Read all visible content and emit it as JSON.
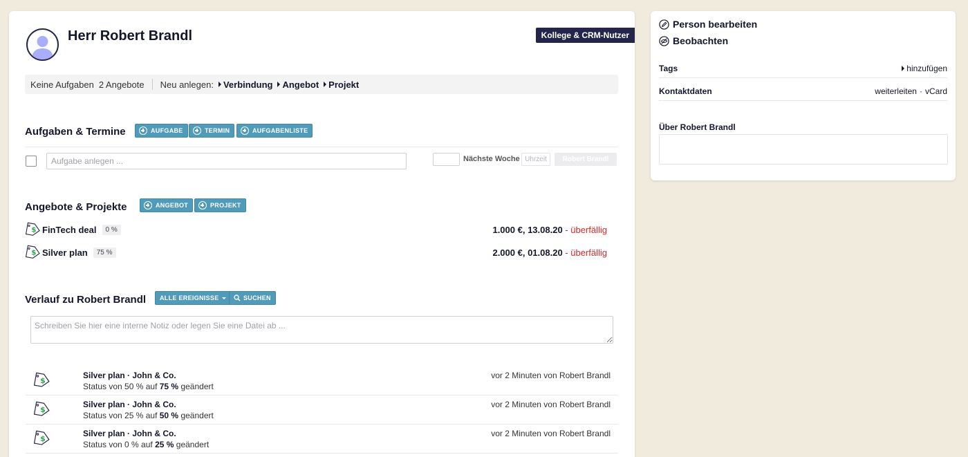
{
  "person": {
    "name": "Herr Robert Brandl",
    "role_badge": "Kollege & CRM-Nutzer"
  },
  "summary": {
    "tasks": "Keine Aufgaben",
    "offers": "2 Angebote",
    "new_label": "Neu anlegen:",
    "new_links": [
      "Verbindung",
      "Angebot",
      "Projekt"
    ]
  },
  "tasks_section": {
    "title": "Aufgaben & Termine",
    "buttons": [
      "AUFGABE",
      "TERMIN",
      "AUFGABENLISTE"
    ],
    "input_placeholder": "Aufgabe anlegen ...",
    "due_label": "Nächste Woche",
    "time_placeholder": "Uhrzeit",
    "assignee": "Robert Brandl"
  },
  "deals_section": {
    "title": "Angebote & Projekte",
    "buttons": [
      "ANGEBOT",
      "PROJEKT"
    ],
    "deals": [
      {
        "name": "FinTech deal",
        "percent": "0 %",
        "amount_date": "1.000 €, 13.08.20",
        "status": "- überfällig"
      },
      {
        "name": "Silver plan",
        "percent": "75 %",
        "amount_date": "2.000 €, 01.08.20",
        "status": "- überfällig"
      }
    ]
  },
  "history_section": {
    "title": "Verlauf zu Robert Brandl",
    "filter_button": "ALLE EREIGNISSE",
    "search_button": "SUCHEN",
    "note_placeholder": "Schreiben Sie hier eine interne Notiz oder legen Sie eine Datei ab ...",
    "events": [
      {
        "title": "Silver plan · John & Co.",
        "desc_prefix": "Status von 50 % auf",
        "desc_value": "75 %",
        "desc_suffix": "geändert",
        "meta": "vor 2 Minuten von Robert Brandl"
      },
      {
        "title": "Silver plan · John & Co.",
        "desc_prefix": "Status von 25 % auf",
        "desc_value": "50 %",
        "desc_suffix": "geändert",
        "meta": "vor 2 Minuten von Robert Brandl"
      },
      {
        "title": "Silver plan · John & Co.",
        "desc_prefix": "Status von 0 % auf",
        "desc_value": "25 %",
        "desc_suffix": "geändert",
        "meta": "vor 2 Minuten von Robert Brandl"
      }
    ]
  },
  "sidebar": {
    "edit_person": "Person bearbeiten",
    "observe": "Beobachten",
    "tags_label": "Tags",
    "tags_add": "hinzufügen",
    "contact_label": "Kontaktdaten",
    "contact_forward": "weiterleiten",
    "contact_sep": "·",
    "contact_vcard": "vCard",
    "about_label": "Über Robert Brandl"
  },
  "colors": {
    "accent_teal": "#4f9bb9",
    "navy": "#23264a",
    "overdue_red": "#d62828",
    "money_green": "#2fa84f",
    "background": "#f0ebdd"
  }
}
